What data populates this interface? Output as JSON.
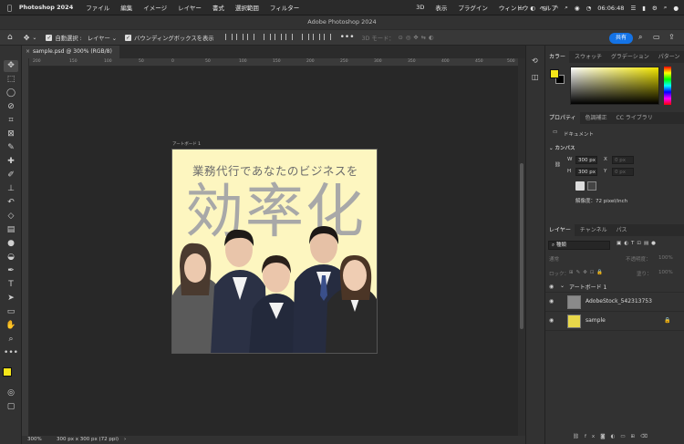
{
  "menubar": {
    "apple": "",
    "app": "Photoshop 2024",
    "items": [
      "ファイル",
      "編集",
      "イメージ",
      "レイヤー",
      "書式",
      "選択範囲",
      "フィルター",
      "3D",
      "表示",
      "プラグイン",
      "ウィンドウ",
      "ヘルプ"
    ],
    "time": "06:06:48"
  },
  "window_title": "Adobe Photoshop 2024",
  "options": {
    "auto_select": "自動選択 :",
    "auto_select_value": "レイヤー",
    "bounding_box": "バウンディングボックスを表示",
    "mode_3d": "3D モード：",
    "share": "共有"
  },
  "document_tab": "sample.psd @ 300% (RGB/8)",
  "ruler_ticks": [
    "200",
    "150",
    "100",
    "50",
    "0",
    "50",
    "100",
    "150",
    "200",
    "250",
    "300",
    "350",
    "400",
    "450",
    "500"
  ],
  "artboard": {
    "label": "アートボード 1",
    "headline": "業務代行であなたのビジネスを",
    "big_text": "効率化"
  },
  "status": {
    "zoom": "300%",
    "doc_size": "300 px x 300 px (72 ppi)"
  },
  "color_panel": {
    "tabs": [
      "カラー",
      "スウォッチ",
      "グラデーション",
      "パターン"
    ],
    "foreground": "#f5e61a",
    "background": "#000000"
  },
  "properties_panel": {
    "tabs": [
      "プロパティ",
      "色調補正",
      "CC ライブラリ"
    ],
    "doc_label": "ドキュメント",
    "canvas_label": "カンバス",
    "w_label": "W",
    "w_value": "300 px",
    "h_label": "H",
    "h_value": "300 px",
    "x_label": "X",
    "x_value": "0 px",
    "y_label": "Y",
    "y_value": "0 px",
    "resolution": "解像度：72 pixel/inch"
  },
  "layers_panel": {
    "tabs": [
      "レイヤー",
      "チャンネル",
      "パス"
    ],
    "filter": "種類",
    "blend_mode": "通常",
    "opacity_label": "不透明度：",
    "opacity_value": "100%",
    "lock_label": "ロック：",
    "fill_label": "塗り：",
    "fill_value": "100%",
    "layers": [
      {
        "name": "アートボード 1"
      },
      {
        "name": "AdobeStock_542313753"
      },
      {
        "name": "sample"
      }
    ]
  }
}
